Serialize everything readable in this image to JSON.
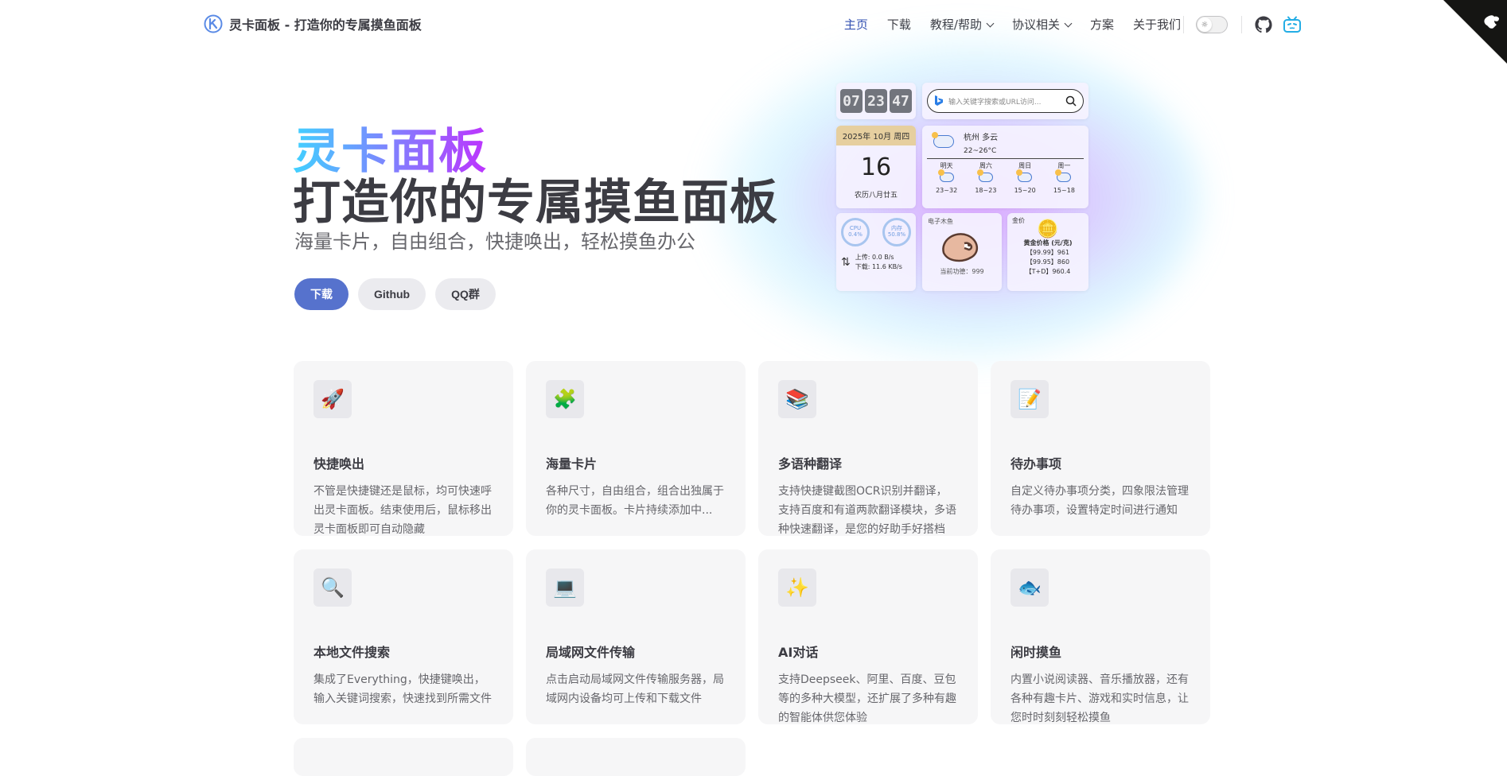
{
  "brand": {
    "title": "灵卡面板 - 打造你的专属摸鱼面板",
    "logo_icon": "lingka-logo-icon"
  },
  "nav": {
    "home": "主页",
    "download": "下载",
    "tutorial": "教程/帮助",
    "protocol": "协议相关",
    "plans": "方案",
    "about": "关于我们"
  },
  "hero": {
    "name": "灵卡面板",
    "text": "打造你的专属摸鱼面板",
    "tagline": "海量卡片，自由组合，快捷唤出，轻松摸鱼办公",
    "actions": {
      "download": "下载",
      "github": "Github",
      "qq": "QQ群"
    }
  },
  "preview": {
    "clock": [
      "07",
      "23",
      "47"
    ],
    "search_placeholder": "输入关键字搜索或URL访问...",
    "date_header": "2025年 10月 周四",
    "date_day": "16",
    "date_lunar": "农历八月廿五",
    "weather_city": "杭州 多云",
    "weather_temp": "22~26°C",
    "forecast": [
      {
        "day": "明天",
        "temp": "23~32"
      },
      {
        "day": "周六",
        "temp": "18~23"
      },
      {
        "day": "周日",
        "temp": "15~20"
      },
      {
        "day": "周一",
        "temp": "15~18"
      }
    ],
    "cpu_label": "CPU",
    "cpu_value": "0.4%",
    "mem_label": "内存",
    "mem_value": "50.8%",
    "upload": "上传: 0.0 B/s",
    "download": "下载: 11.6 KB/s",
    "fish_label": "电子木鱼",
    "fish_merit": "当前功德：999",
    "gold_label": "金价",
    "gold_title": "黄金价格 (元/克)",
    "gold_rows": [
      "【99.99】961",
      "【99.95】860",
      "【T+D】960.4"
    ]
  },
  "features": [
    {
      "icon": "🚀",
      "icon_name": "rocket-icon",
      "title": "快捷唤出",
      "details": "不管是快捷键还是鼠标，均可快速呼出灵卡面板。结束使用后，鼠标移出灵卡面板即可自动隐藏"
    },
    {
      "icon": "🧩",
      "icon_name": "puzzle-icon",
      "title": "海量卡片",
      "details": "各种尺寸，自由组合，组合出独属于你的灵卡面板。卡片持续添加中..."
    },
    {
      "icon": "📚",
      "icon_name": "books-icon",
      "title": "多语种翻译",
      "details": "支持快捷键截图OCR识别并翻译，支持百度和有道两款翻译模块，多语种快速翻译，是您的好助手好搭档"
    },
    {
      "icon": "📝",
      "icon_name": "memo-icon",
      "title": "待办事项",
      "details": "自定义待办事项分类，四象限法管理待办事项，设置特定时间进行通知"
    },
    {
      "icon": "🔍",
      "icon_name": "magnifier-icon",
      "title": "本地文件搜索",
      "details": "集成了Everything，快捷键唤出，输入关键词搜索，快速找到所需文件"
    },
    {
      "icon": "💻",
      "icon_name": "laptop-icon",
      "title": "局域网文件传输",
      "details": "点击启动局域网文件传输服务器，局域网内设备均可上传和下载文件"
    },
    {
      "icon": "✨",
      "icon_name": "sparkles-icon",
      "title": "AI对话",
      "details": "支持Deepseek、阿里、百度、豆包等的多种大模型，还扩展了多种有趣的智能体供您体验"
    },
    {
      "icon": "🐟",
      "icon_name": "fish-icon",
      "title": "闲时摸鱼",
      "details": "内置小说阅读器、音乐播放器，还有各种有趣卡片、游戏和实时信息，让您时时刻刻轻松摸鱼"
    }
  ],
  "colors": {
    "brand": "#5672cd",
    "nav_active": "#3451b2",
    "hero_gradient_start": "#41d1ff",
    "hero_gradient_end": "#bd34fe"
  }
}
